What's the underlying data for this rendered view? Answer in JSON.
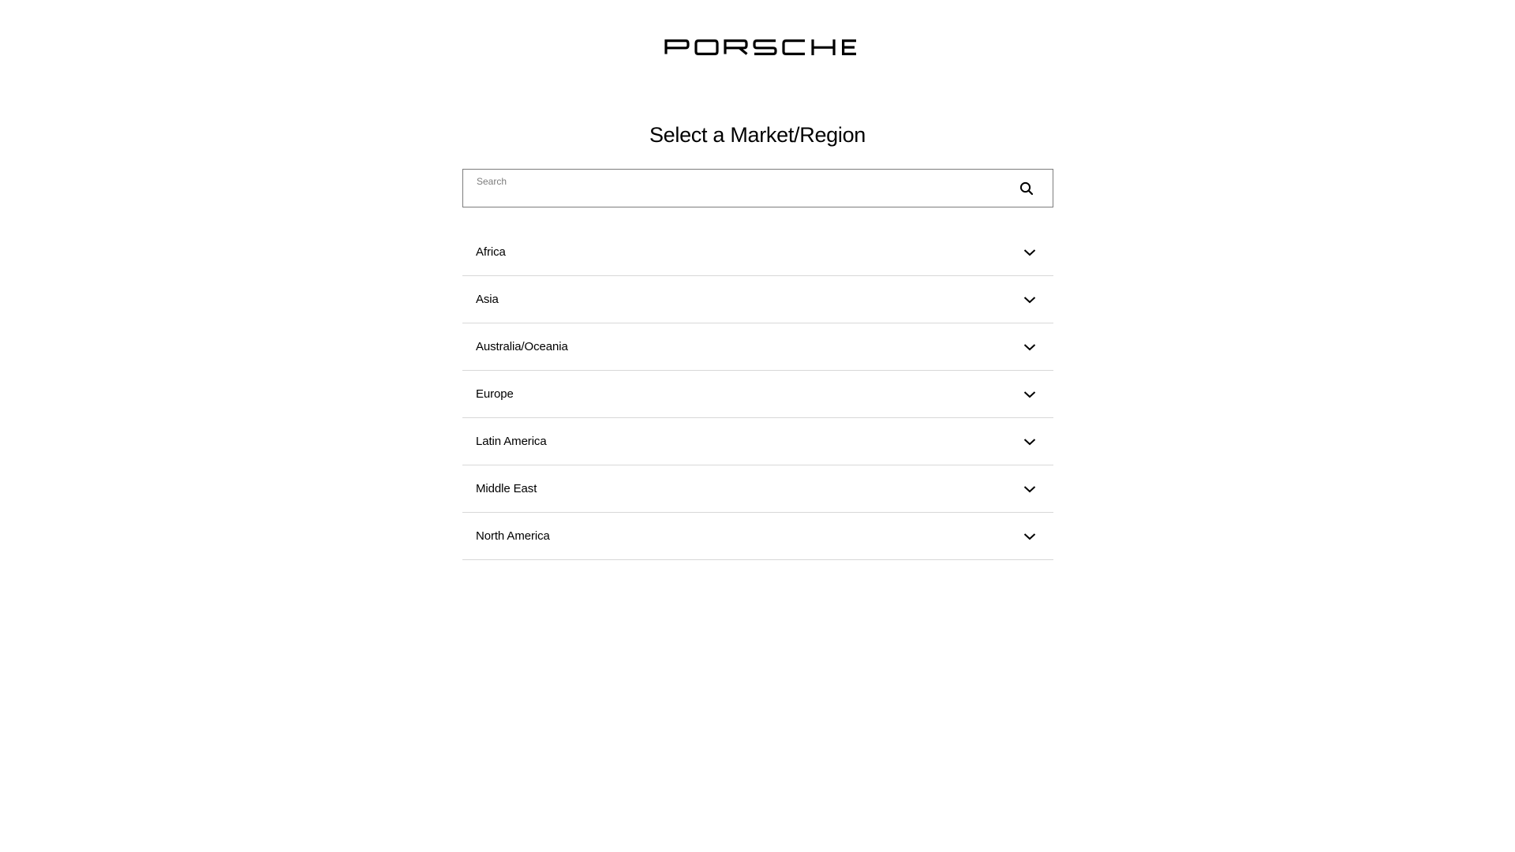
{
  "header": {
    "logo_text": "PORSCHE",
    "logo_icon": "porsche-wordmark"
  },
  "main": {
    "title": "Select a Market/Region",
    "search": {
      "label": "Search",
      "value": "",
      "icon": "search-icon"
    },
    "regions": [
      {
        "label": "Africa",
        "icon": "chevron-down-icon"
      },
      {
        "label": "Asia",
        "icon": "chevron-down-icon"
      },
      {
        "label": "Australia/Oceania",
        "icon": "chevron-down-icon"
      },
      {
        "label": "Europe",
        "icon": "chevron-down-icon"
      },
      {
        "label": "Latin America",
        "icon": "chevron-down-icon"
      },
      {
        "label": "Middle East",
        "icon": "chevron-down-icon"
      },
      {
        "label": "North America",
        "icon": "chevron-down-icon"
      }
    ]
  },
  "colors": {
    "text": "#000000",
    "border": "#7c7c7c",
    "divider": "#d8d8d8",
    "background": "#ffffff"
  }
}
